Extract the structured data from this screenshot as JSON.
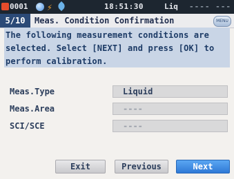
{
  "status": {
    "counter": "0001",
    "time": "18:51:30",
    "mode": "Liq",
    "extra": "----  ----",
    "icons": [
      "stop-icon",
      "moon-icon",
      "bolt-icon",
      "leaf-icon"
    ]
  },
  "titlebar": {
    "page": "5/10",
    "title": "Meas. Condition Confirmation",
    "menu_icon_text": "MENU"
  },
  "message": {
    "text": "The following measurement conditions are selected. Select [NEXT] and press [OK] to perform calibration."
  },
  "fields": [
    {
      "label": "Meas.Type",
      "value": "Liquid"
    },
    {
      "label": "Meas.Area",
      "value": "----"
    },
    {
      "label": "SCI/SCE",
      "value": "----"
    }
  ],
  "buttons": {
    "exit": "Exit",
    "previous": "Previous",
    "next": "Next"
  },
  "colors": {
    "accent": "#2f79d6",
    "title_bg": "#2b4a77",
    "message_bg": "#c9d5e6"
  }
}
